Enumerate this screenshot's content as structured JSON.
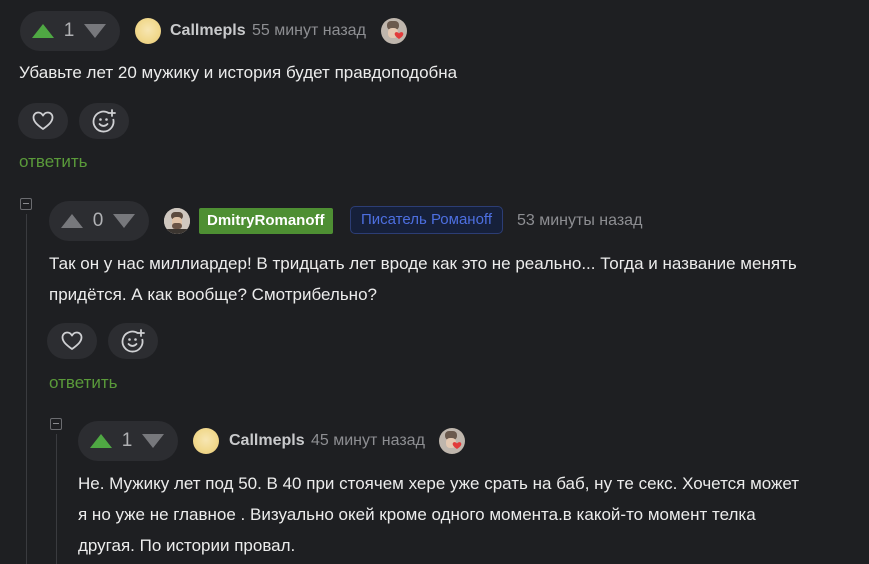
{
  "comments": [
    {
      "votes": "1",
      "username": "Callmepls",
      "time": "55 минут назад",
      "text": "Убавьте лет 20 мужику и история будет правдоподобна",
      "reply_label": "ответить"
    },
    {
      "votes": "0",
      "username": "DmitryRomanoff",
      "badge": "Писатель Романoff",
      "time": "53 минуты назад",
      "text_line1": "Так он у нас миллиардер! В тридцать лет вроде как это не реально... Тогда и название менять",
      "text_line2": "придётся. А как вообще? Смотрибельно?",
      "reply_label": "ответить"
    },
    {
      "votes": "1",
      "username": "Callmepls",
      "time": "45 минут назад",
      "text_line1": "Не. Мужику лет под 50. В 40 при стоячем хере уже срать на баб, ну те секс. Хочется может",
      "text_line2": "я но уже не главное . Визуально окей кроме одного момента.в какой-то момент телка",
      "text_line3": "другая. По истории провал."
    }
  ],
  "colors": {
    "background": "#1e1f22",
    "upvote": "#4fa843",
    "reply": "#5a9a3a",
    "username_tag": "#4e8f33",
    "badge_text": "#4d6fe0"
  }
}
